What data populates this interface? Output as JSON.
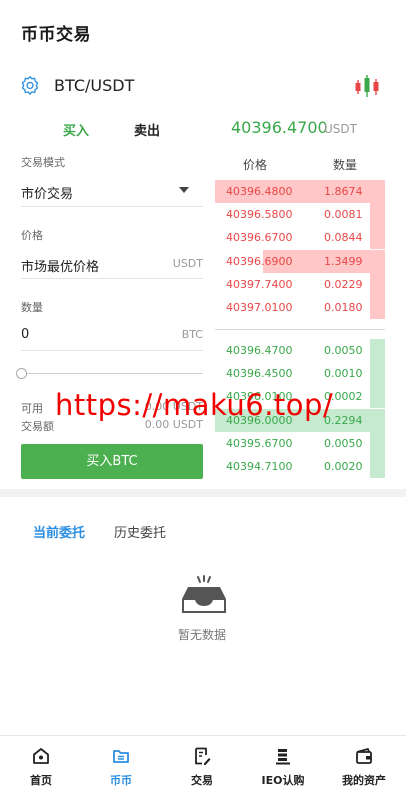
{
  "header": {
    "title": "币币交易"
  },
  "pair": {
    "name": "BTC/USDT",
    "settings_icon": "gear-icon",
    "chart_icon": "candlestick-icon"
  },
  "trade_tabs": {
    "buy": "买入",
    "sell": "卖出"
  },
  "ticker": {
    "last_price": "40396.4700",
    "unit": "USDT"
  },
  "form": {
    "mode_label": "交易模式",
    "mode_value": "市价交易",
    "price_label": "价格",
    "price_value": "市场最优价格",
    "price_unit": "USDT",
    "amount_label": "数量",
    "amount_value": "0",
    "amount_unit": "BTC",
    "slider_percent": 0,
    "available_label": "可用",
    "available_value": "0.00 USDT",
    "turnover_label": "交易额",
    "turnover_value": "0.00 USDT",
    "submit_label": "买入BTC"
  },
  "orderbook": {
    "price_header": "价格",
    "qty_header": "数量",
    "asks": [
      {
        "price": "40396.4800",
        "qty": "1.8674",
        "depth": 1.0
      },
      {
        "price": "40396.5800",
        "qty": "0.0081",
        "depth": 0.09
      },
      {
        "price": "40396.6700",
        "qty": "0.0844",
        "depth": 0.09
      },
      {
        "price": "40396.6900",
        "qty": "1.3499",
        "depth": 0.72
      },
      {
        "price": "40397.7400",
        "qty": "0.0229",
        "depth": 0.09
      },
      {
        "price": "40397.0100",
        "qty": "0.0180",
        "depth": 0.09
      }
    ],
    "bids": [
      {
        "price": "40396.4700",
        "qty": "0.0050",
        "depth": 0.09
      },
      {
        "price": "40396.4500",
        "qty": "0.0010",
        "depth": 0.09
      },
      {
        "price": "40396.0100",
        "qty": "0.0002",
        "depth": 0.09
      },
      {
        "price": "40396.0000",
        "qty": "0.2294",
        "depth": 1.0
      },
      {
        "price": "40395.6700",
        "qty": "0.0050",
        "depth": 0.09
      },
      {
        "price": "40394.7100",
        "qty": "0.0020",
        "depth": 0.09
      }
    ]
  },
  "watermark": "https://maku6.top/",
  "orders": {
    "tab_current": "当前委托",
    "tab_history": "历史委托",
    "empty_icon": "empty-box-icon",
    "empty_text": "暂无数据"
  },
  "nav": [
    {
      "label": "首页",
      "icon": "home-icon"
    },
    {
      "label": "币币",
      "icon": "wallet-icon",
      "active": true
    },
    {
      "label": "交易",
      "icon": "document-edit-icon"
    },
    {
      "label": "IEO认购",
      "icon": "coin-stack-icon"
    },
    {
      "label": "我的资产",
      "icon": "purse-icon"
    }
  ],
  "colors": {
    "buy_green": "#3aa84a",
    "sell_red": "#e94747",
    "accent_blue": "#2d8fe2",
    "button_green": "#4caf50"
  }
}
